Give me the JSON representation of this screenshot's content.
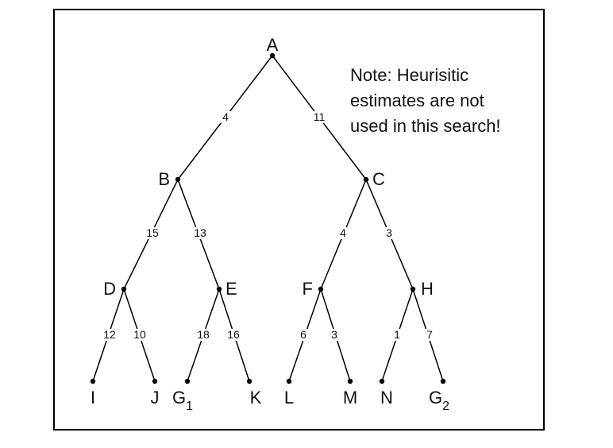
{
  "note": {
    "lines": [
      "Note: Heurisitic",
      "estimates are not",
      "used in this search!"
    ]
  },
  "nodes": [
    {
      "id": "A",
      "label": "A"
    },
    {
      "id": "B",
      "label": "B"
    },
    {
      "id": "C",
      "label": "C"
    },
    {
      "id": "D",
      "label": "D"
    },
    {
      "id": "E",
      "label": "E"
    },
    {
      "id": "F",
      "label": "F"
    },
    {
      "id": "H",
      "label": "H"
    },
    {
      "id": "I",
      "label": "I"
    },
    {
      "id": "J",
      "label": "J"
    },
    {
      "id": "G1",
      "label": "G",
      "sub": "1"
    },
    {
      "id": "K",
      "label": "K"
    },
    {
      "id": "L",
      "label": "L"
    },
    {
      "id": "M",
      "label": "M"
    },
    {
      "id": "N",
      "label": "N"
    },
    {
      "id": "G2",
      "label": "G",
      "sub": "2"
    }
  ],
  "edges": [
    {
      "from": "A",
      "to": "B",
      "cost": "4"
    },
    {
      "from": "A",
      "to": "C",
      "cost": "11"
    },
    {
      "from": "B",
      "to": "D",
      "cost": "15"
    },
    {
      "from": "B",
      "to": "E",
      "cost": "13"
    },
    {
      "from": "C",
      "to": "F",
      "cost": "4"
    },
    {
      "from": "C",
      "to": "H",
      "cost": "3"
    },
    {
      "from": "D",
      "to": "I",
      "cost": "12"
    },
    {
      "from": "D",
      "to": "J",
      "cost": "10"
    },
    {
      "from": "E",
      "to": "G1",
      "cost": "18"
    },
    {
      "from": "E",
      "to": "K",
      "cost": "16"
    },
    {
      "from": "F",
      "to": "L",
      "cost": "6"
    },
    {
      "from": "F",
      "to": "M",
      "cost": "3"
    },
    {
      "from": "H",
      "to": "N",
      "cost": "1"
    },
    {
      "from": "H",
      "to": "G2",
      "cost": "7"
    }
  ]
}
